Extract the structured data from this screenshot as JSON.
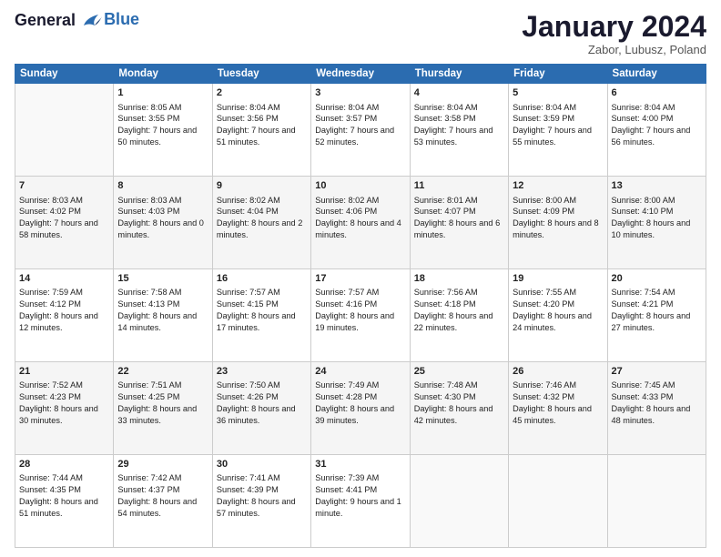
{
  "logo": {
    "line1": "General",
    "line2": "Blue"
  },
  "header": {
    "month": "January 2024",
    "location": "Zabor, Lubusz, Poland"
  },
  "weekdays": [
    "Sunday",
    "Monday",
    "Tuesday",
    "Wednesday",
    "Thursday",
    "Friday",
    "Saturday"
  ],
  "weeks": [
    [
      {
        "day": "",
        "sunrise": "",
        "sunset": "",
        "daylight": ""
      },
      {
        "day": "1",
        "sunrise": "Sunrise: 8:05 AM",
        "sunset": "Sunset: 3:55 PM",
        "daylight": "Daylight: 7 hours and 50 minutes."
      },
      {
        "day": "2",
        "sunrise": "Sunrise: 8:04 AM",
        "sunset": "Sunset: 3:56 PM",
        "daylight": "Daylight: 7 hours and 51 minutes."
      },
      {
        "day": "3",
        "sunrise": "Sunrise: 8:04 AM",
        "sunset": "Sunset: 3:57 PM",
        "daylight": "Daylight: 7 hours and 52 minutes."
      },
      {
        "day": "4",
        "sunrise": "Sunrise: 8:04 AM",
        "sunset": "Sunset: 3:58 PM",
        "daylight": "Daylight: 7 hours and 53 minutes."
      },
      {
        "day": "5",
        "sunrise": "Sunrise: 8:04 AM",
        "sunset": "Sunset: 3:59 PM",
        "daylight": "Daylight: 7 hours and 55 minutes."
      },
      {
        "day": "6",
        "sunrise": "Sunrise: 8:04 AM",
        "sunset": "Sunset: 4:00 PM",
        "daylight": "Daylight: 7 hours and 56 minutes."
      }
    ],
    [
      {
        "day": "7",
        "sunrise": "Sunrise: 8:03 AM",
        "sunset": "Sunset: 4:02 PM",
        "daylight": "Daylight: 7 hours and 58 minutes."
      },
      {
        "day": "8",
        "sunrise": "Sunrise: 8:03 AM",
        "sunset": "Sunset: 4:03 PM",
        "daylight": "Daylight: 8 hours and 0 minutes."
      },
      {
        "day": "9",
        "sunrise": "Sunrise: 8:02 AM",
        "sunset": "Sunset: 4:04 PM",
        "daylight": "Daylight: 8 hours and 2 minutes."
      },
      {
        "day": "10",
        "sunrise": "Sunrise: 8:02 AM",
        "sunset": "Sunset: 4:06 PM",
        "daylight": "Daylight: 8 hours and 4 minutes."
      },
      {
        "day": "11",
        "sunrise": "Sunrise: 8:01 AM",
        "sunset": "Sunset: 4:07 PM",
        "daylight": "Daylight: 8 hours and 6 minutes."
      },
      {
        "day": "12",
        "sunrise": "Sunrise: 8:00 AM",
        "sunset": "Sunset: 4:09 PM",
        "daylight": "Daylight: 8 hours and 8 minutes."
      },
      {
        "day": "13",
        "sunrise": "Sunrise: 8:00 AM",
        "sunset": "Sunset: 4:10 PM",
        "daylight": "Daylight: 8 hours and 10 minutes."
      }
    ],
    [
      {
        "day": "14",
        "sunrise": "Sunrise: 7:59 AM",
        "sunset": "Sunset: 4:12 PM",
        "daylight": "Daylight: 8 hours and 12 minutes."
      },
      {
        "day": "15",
        "sunrise": "Sunrise: 7:58 AM",
        "sunset": "Sunset: 4:13 PM",
        "daylight": "Daylight: 8 hours and 14 minutes."
      },
      {
        "day": "16",
        "sunrise": "Sunrise: 7:57 AM",
        "sunset": "Sunset: 4:15 PM",
        "daylight": "Daylight: 8 hours and 17 minutes."
      },
      {
        "day": "17",
        "sunrise": "Sunrise: 7:57 AM",
        "sunset": "Sunset: 4:16 PM",
        "daylight": "Daylight: 8 hours and 19 minutes."
      },
      {
        "day": "18",
        "sunrise": "Sunrise: 7:56 AM",
        "sunset": "Sunset: 4:18 PM",
        "daylight": "Daylight: 8 hours and 22 minutes."
      },
      {
        "day": "19",
        "sunrise": "Sunrise: 7:55 AM",
        "sunset": "Sunset: 4:20 PM",
        "daylight": "Daylight: 8 hours and 24 minutes."
      },
      {
        "day": "20",
        "sunrise": "Sunrise: 7:54 AM",
        "sunset": "Sunset: 4:21 PM",
        "daylight": "Daylight: 8 hours and 27 minutes."
      }
    ],
    [
      {
        "day": "21",
        "sunrise": "Sunrise: 7:52 AM",
        "sunset": "Sunset: 4:23 PM",
        "daylight": "Daylight: 8 hours and 30 minutes."
      },
      {
        "day": "22",
        "sunrise": "Sunrise: 7:51 AM",
        "sunset": "Sunset: 4:25 PM",
        "daylight": "Daylight: 8 hours and 33 minutes."
      },
      {
        "day": "23",
        "sunrise": "Sunrise: 7:50 AM",
        "sunset": "Sunset: 4:26 PM",
        "daylight": "Daylight: 8 hours and 36 minutes."
      },
      {
        "day": "24",
        "sunrise": "Sunrise: 7:49 AM",
        "sunset": "Sunset: 4:28 PM",
        "daylight": "Daylight: 8 hours and 39 minutes."
      },
      {
        "day": "25",
        "sunrise": "Sunrise: 7:48 AM",
        "sunset": "Sunset: 4:30 PM",
        "daylight": "Daylight: 8 hours and 42 minutes."
      },
      {
        "day": "26",
        "sunrise": "Sunrise: 7:46 AM",
        "sunset": "Sunset: 4:32 PM",
        "daylight": "Daylight: 8 hours and 45 minutes."
      },
      {
        "day": "27",
        "sunrise": "Sunrise: 7:45 AM",
        "sunset": "Sunset: 4:33 PM",
        "daylight": "Daylight: 8 hours and 48 minutes."
      }
    ],
    [
      {
        "day": "28",
        "sunrise": "Sunrise: 7:44 AM",
        "sunset": "Sunset: 4:35 PM",
        "daylight": "Daylight: 8 hours and 51 minutes."
      },
      {
        "day": "29",
        "sunrise": "Sunrise: 7:42 AM",
        "sunset": "Sunset: 4:37 PM",
        "daylight": "Daylight: 8 hours and 54 minutes."
      },
      {
        "day": "30",
        "sunrise": "Sunrise: 7:41 AM",
        "sunset": "Sunset: 4:39 PM",
        "daylight": "Daylight: 8 hours and 57 minutes."
      },
      {
        "day": "31",
        "sunrise": "Sunrise: 7:39 AM",
        "sunset": "Sunset: 4:41 PM",
        "daylight": "Daylight: 9 hours and 1 minute."
      },
      {
        "day": "",
        "sunrise": "",
        "sunset": "",
        "daylight": ""
      },
      {
        "day": "",
        "sunrise": "",
        "sunset": "",
        "daylight": ""
      },
      {
        "day": "",
        "sunrise": "",
        "sunset": "",
        "daylight": ""
      }
    ]
  ]
}
